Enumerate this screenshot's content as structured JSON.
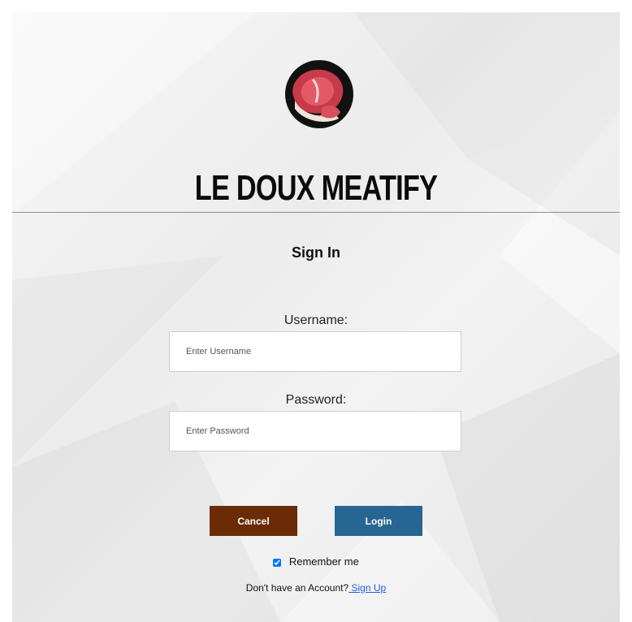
{
  "brand": {
    "name": "LE DOUX MEATIFY",
    "logo": "steak-icon"
  },
  "form": {
    "title": "Sign In",
    "username": {
      "label": "Username:",
      "placeholder": "Enter Username",
      "value": ""
    },
    "password": {
      "label": "Password:",
      "placeholder": "Enter Password",
      "value": ""
    },
    "cancel_label": "Cancel",
    "login_label": "Login",
    "remember_label": "Remember me",
    "remember_checked": true,
    "no_account_text": "Don't have an Account?",
    "signup_label": " Sign Up"
  },
  "colors": {
    "cancel_button": "#6b2b06",
    "login_button": "#276592",
    "link": "#1f5fe0"
  }
}
